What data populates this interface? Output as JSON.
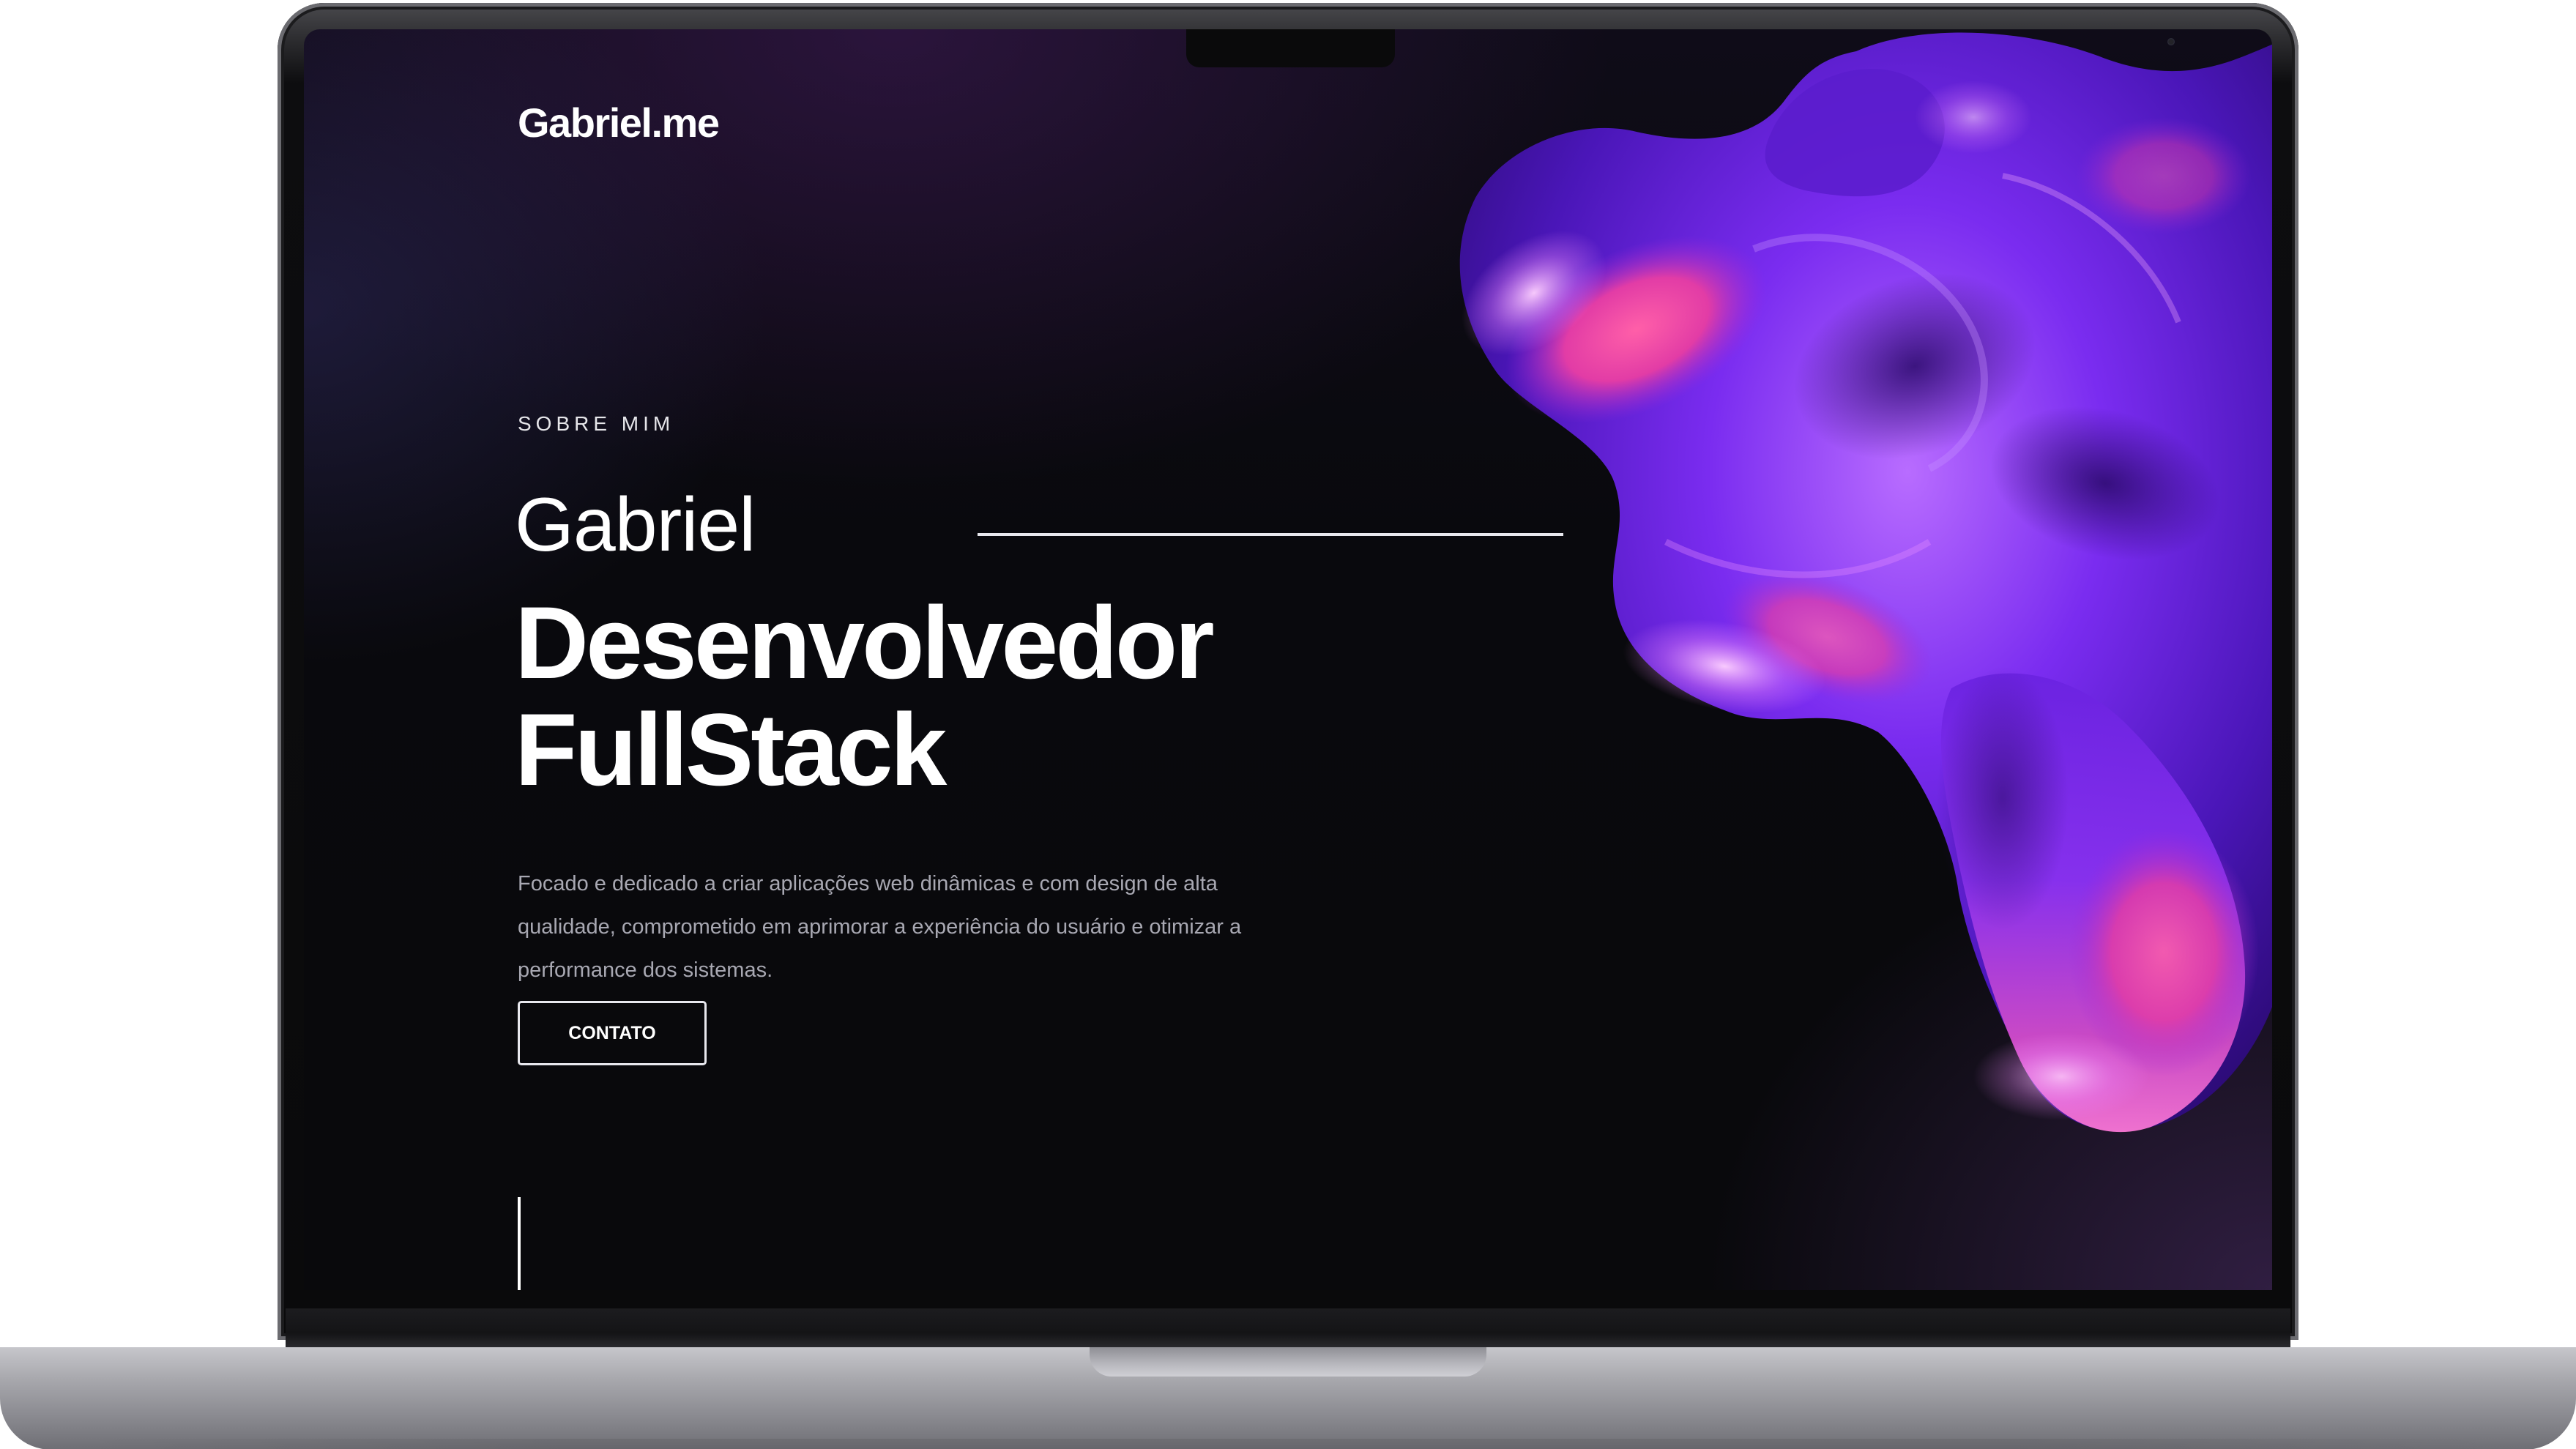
{
  "site": {
    "logo": "Gabriel.me"
  },
  "hero": {
    "section_label": "SOBRE MIM",
    "name": "Gabriel",
    "headline_line1": "Desenvolvedor",
    "headline_line2": "FullStack",
    "description": "Focado e dedicado a criar aplicações web dinâmicas e com design de alta qualidade, comprometido em aprimorar a experiência do usuário e otimizar a performance dos sistemas.",
    "contact_button": "CONTATO"
  },
  "colors": {
    "background": "#09090c",
    "text_primary": "#ffffff",
    "text_secondary": "#a8a8b2",
    "accent_purple": "#7b2cf0",
    "accent_pink": "#f0419a"
  },
  "icons": {
    "hero_art": "abstract-3d-blob-image",
    "scroll": "scroll-indicator-line"
  }
}
